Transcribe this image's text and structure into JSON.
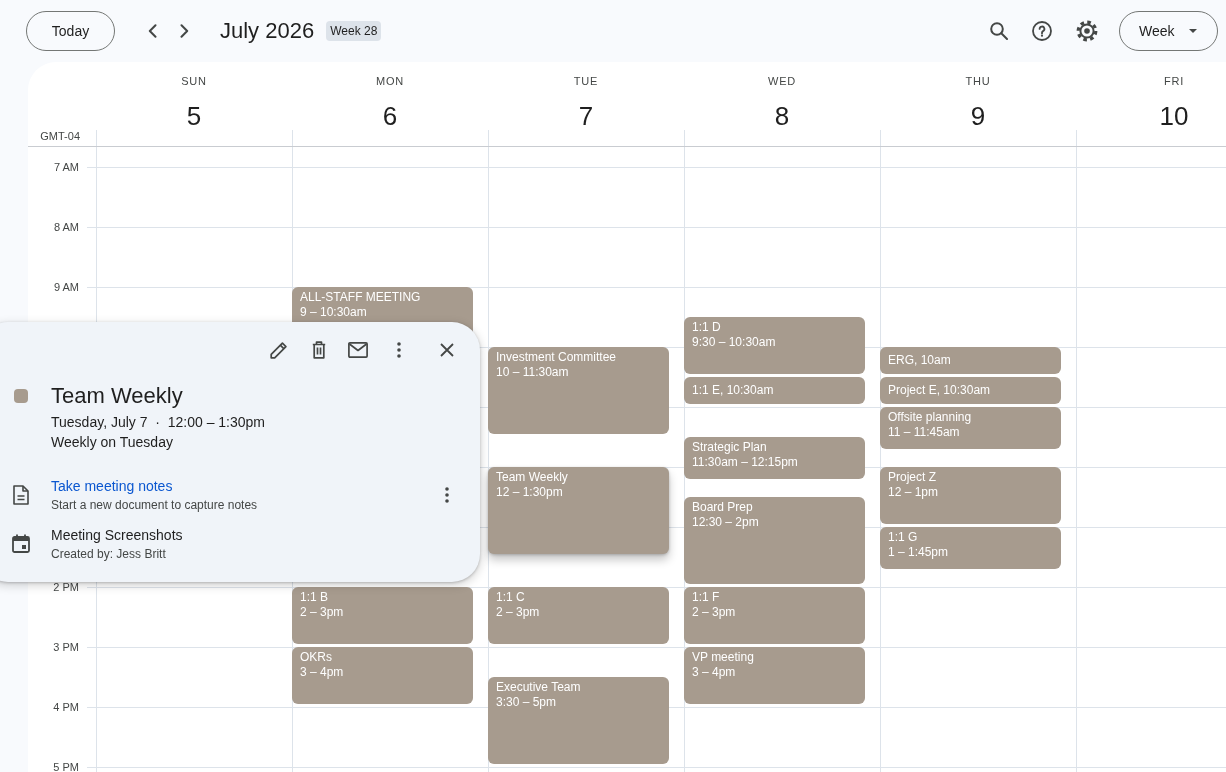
{
  "toolbar": {
    "today_button": "Today",
    "month": "July 2026",
    "week_badge": "Week 28",
    "view_selector": "Week"
  },
  "timezone": "GMT-04",
  "hour_labels": [
    "7 AM",
    "8 AM",
    "9 AM",
    "2 PM",
    "3 PM",
    "4 PM",
    "5 PM"
  ],
  "days": [
    {
      "name": "SUN",
      "number": "5"
    },
    {
      "name": "MON",
      "number": "6",
      "events": [
        {
          "kind": "block",
          "title": "ALL-STAFF MEETING",
          "time": "9 – 10:30am",
          "selected": false
        },
        {
          "kind": "block",
          "title": "1:1 B",
          "time": "2 – 3pm",
          "selected": false
        },
        {
          "kind": "block",
          "title": "OKRs",
          "time": "3 – 4pm",
          "selected": false
        }
      ]
    },
    {
      "name": "TUE",
      "number": "7",
      "events": [
        {
          "kind": "block",
          "title": "Investment Committee",
          "time": "10 – 11:30am",
          "selected": false
        },
        {
          "kind": "block",
          "title": "Team Weekly",
          "time": "12 – 1:30pm",
          "selected": true
        },
        {
          "kind": "block",
          "title": "1:1 C",
          "time": "2 – 3pm",
          "selected": false
        },
        {
          "kind": "block",
          "title": "Executive Team",
          "time": "3:30 – 5pm",
          "selected": false
        }
      ]
    },
    {
      "name": "WED",
      "number": "8",
      "events": [
        {
          "kind": "block",
          "title": "1:1 D",
          "time": "9:30 – 10:30am",
          "selected": false
        },
        {
          "kind": "compact",
          "text": "1:1 E, 10:30am",
          "selected": false
        },
        {
          "kind": "block",
          "title": "Strategic Plan",
          "time": "11:30am – 12:15pm",
          "selected": false
        },
        {
          "kind": "block",
          "title": "Board Prep",
          "time": "12:30 – 2pm",
          "selected": false
        },
        {
          "kind": "block",
          "title": "1:1 F",
          "time": "2 – 3pm",
          "selected": false
        },
        {
          "kind": "block",
          "title": "VP meeting",
          "time": "3 – 4pm",
          "selected": false
        }
      ]
    },
    {
      "name": "THU",
      "number": "9",
      "events": [
        {
          "kind": "compact",
          "text": "ERG, 10am",
          "selected": false
        },
        {
          "kind": "compact",
          "text": "Project E, 10:30am",
          "selected": false
        },
        {
          "kind": "block",
          "title": "Offsite planning",
          "time": "11 – 11:45am",
          "selected": false
        },
        {
          "kind": "block",
          "title": "Project Z",
          "time": "12 – 1pm",
          "selected": false
        },
        {
          "kind": "block",
          "title": "1:1 G",
          "time": "1 – 1:45pm",
          "selected": false
        }
      ]
    },
    {
      "name": "FRI",
      "number": "10"
    }
  ],
  "event_popup": {
    "title": "Team Weekly",
    "when": "Tuesday, July 7  ·  12:00 – 1:30pm",
    "recurrence": "Weekly on Tuesday",
    "items": [
      {
        "kind": "notes",
        "title": "Take meeting notes",
        "subtitle": "Start a new document to capture notes"
      },
      {
        "kind": "calendar",
        "title": "Meeting Screenshots",
        "subtitle": "Created by: Jess Britt"
      }
    ]
  }
}
